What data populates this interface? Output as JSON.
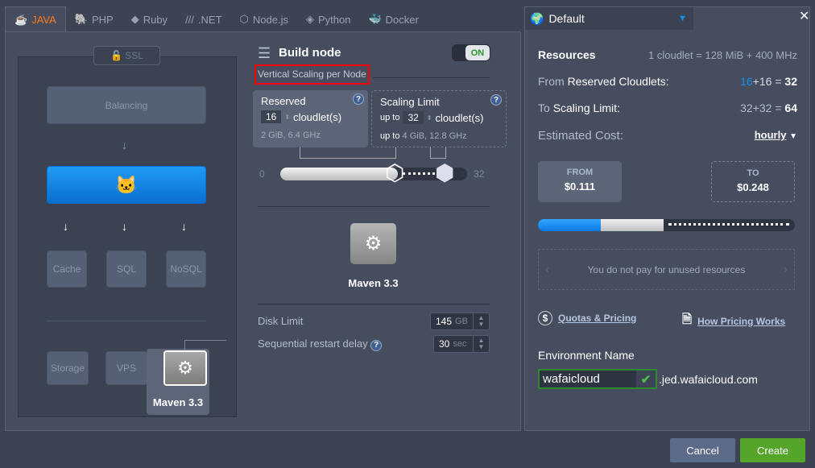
{
  "tabs": [
    {
      "label": "JAVA",
      "icon": "java-icon",
      "active": true
    },
    {
      "label": "PHP",
      "icon": "php-icon"
    },
    {
      "label": "Ruby",
      "icon": "ruby-icon"
    },
    {
      "label": ".NET",
      "icon": "dotnet-icon"
    },
    {
      "label": "Node.js",
      "icon": "nodejs-icon"
    },
    {
      "label": "Python",
      "icon": "python-icon"
    },
    {
      "label": "Docker",
      "icon": "docker-icon"
    }
  ],
  "topology": {
    "ssl": "SSL",
    "balancing": "Balancing",
    "cache": "Cache",
    "sql": "SQL",
    "nosql": "NoSQL",
    "storage": "Storage",
    "vps": "VPS",
    "selected": "Maven 3.3"
  },
  "build": {
    "title": "Build node",
    "toggle": "ON",
    "section": "Vertical Scaling per Node",
    "reserved": {
      "title": "Reserved",
      "value": "16",
      "unit": "cloudlet(s)",
      "info": "2 GiB, 6.4 GHz"
    },
    "limit": {
      "title": "Scaling Limit",
      "prefix": "up to",
      "value": "32",
      "unit": "cloudlet(s)",
      "info_prefix": "up to",
      "info": "4 GiB, 12.8 GHz"
    },
    "slider": {
      "min": "0",
      "max": "32",
      "reserved": 16,
      "limit": 32
    },
    "node_name": "Maven 3.3",
    "disk_label": "Disk Limit",
    "disk_value": "145",
    "disk_unit": "GB",
    "restart_label": "Sequential restart delay",
    "restart_value": "30",
    "restart_unit": "sec"
  },
  "env": {
    "region": "Default",
    "resources_title": "Resources",
    "cloudlet_def": "1 cloudlet = 128 MiB + 400 MHz",
    "from_pre": "From",
    "from_label": "Reserved Cloudlets:",
    "from_a": "16",
    "from_b": "16",
    "from_total": "32",
    "to_pre": "To",
    "to_label": "Scaling Limit:",
    "to_a": "32",
    "to_b": "32",
    "to_total": "64",
    "cost_label": "Estimated Cost:",
    "period": "hourly",
    "from_cap": "FROM",
    "from_price": "$0.111",
    "to_cap": "TO",
    "to_price": "$0.248",
    "notice": "You do not pay for unused resources",
    "quotas": "Quotas & Pricing",
    "how": "How Pricing Works",
    "name_label": "Environment Name",
    "name_value": "wafaicloud",
    "domain": ".jed.wafaicloud.com"
  },
  "footer": {
    "cancel": "Cancel",
    "create": "Create"
  },
  "colors": {
    "accent": "#1a8ef0",
    "create": "#56a52b",
    "highlight": "#ff0000"
  }
}
